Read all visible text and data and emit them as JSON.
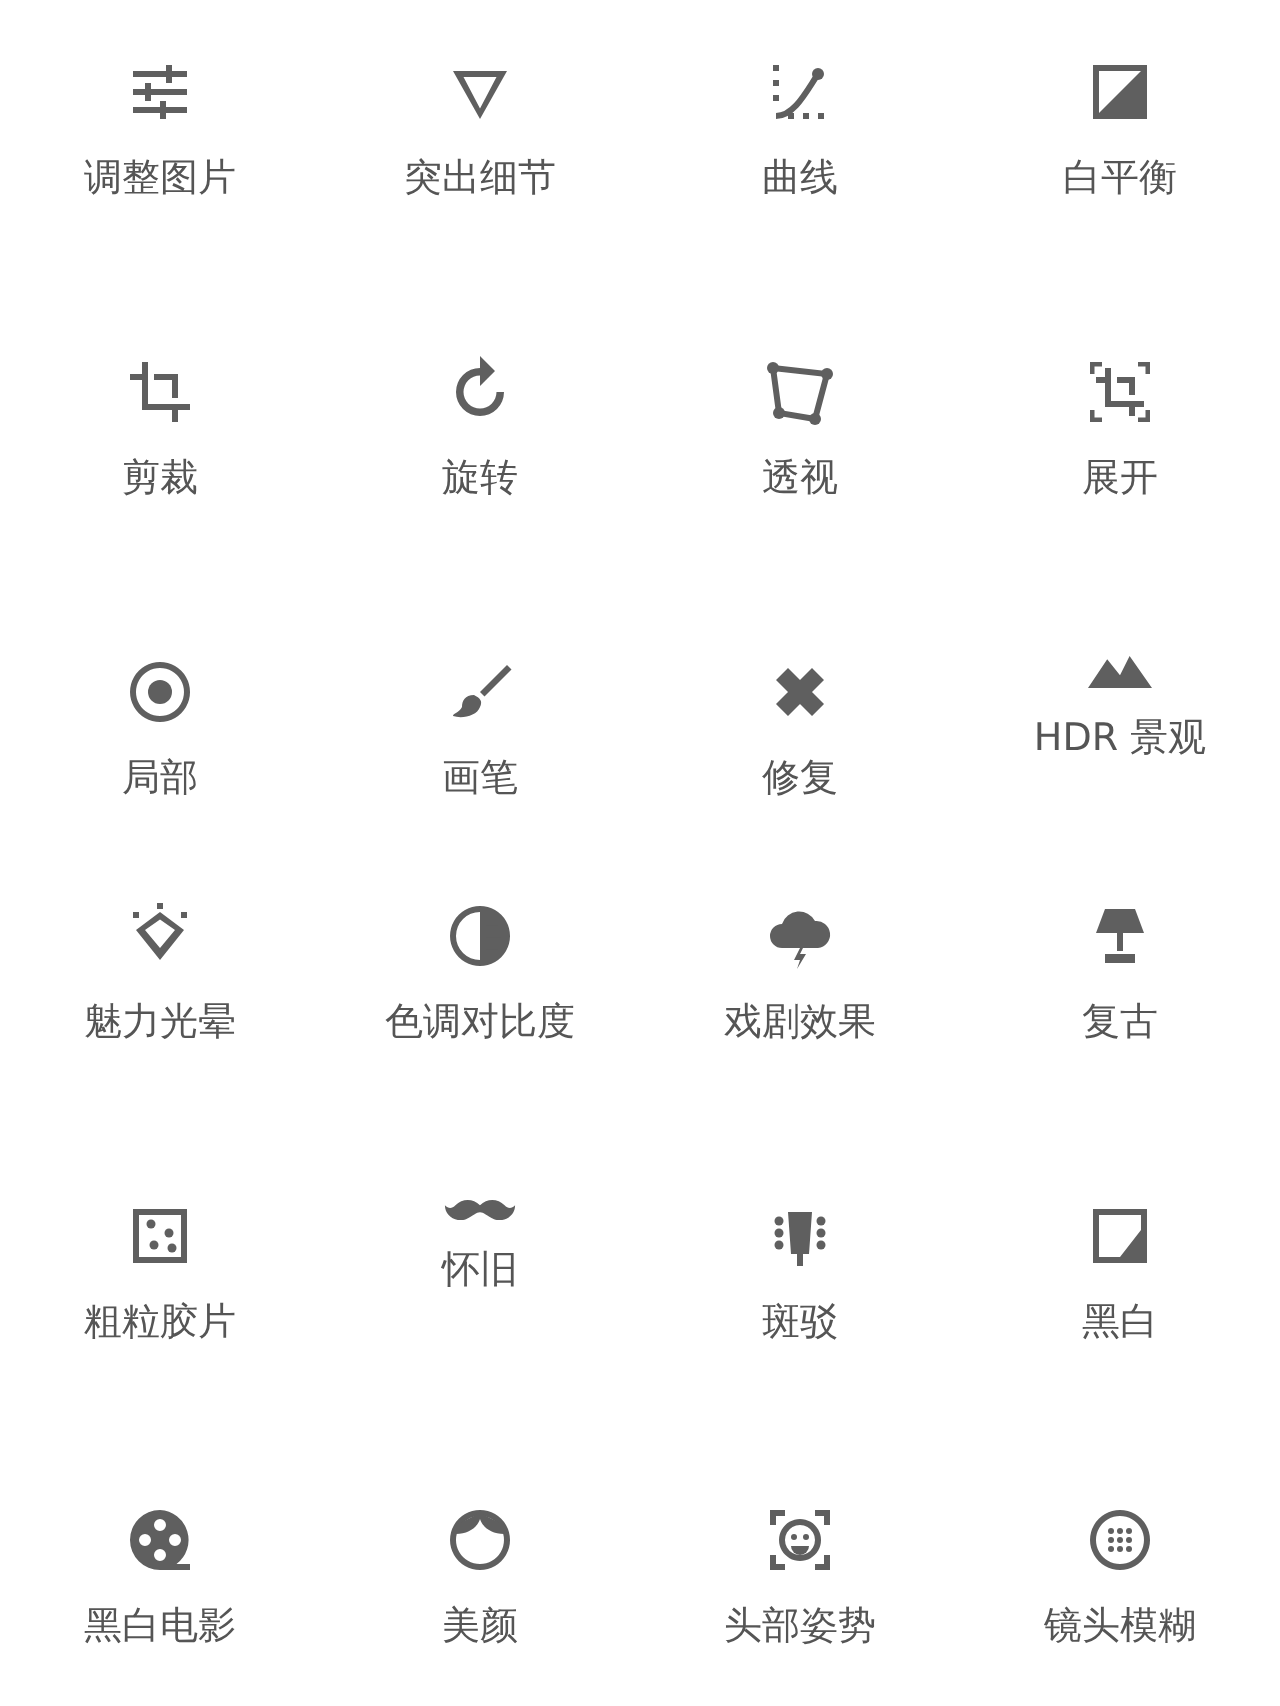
{
  "tools": [
    {
      "label": "调整图片"
    },
    {
      "label": "突出细节"
    },
    {
      "label": "曲线"
    },
    {
      "label": "白平衡"
    },
    {
      "label": "剪裁"
    },
    {
      "label": "旋转"
    },
    {
      "label": "透视"
    },
    {
      "label": "展开"
    },
    {
      "label": "局部"
    },
    {
      "label": "画笔"
    },
    {
      "label": "修复"
    },
    {
      "label": "HDR 景观"
    },
    {
      "label": "魅力光晕"
    },
    {
      "label": "色调对比度"
    },
    {
      "label": "戏剧效果"
    },
    {
      "label": "复古"
    },
    {
      "label": "粗粒胶片"
    },
    {
      "label": "怀旧"
    },
    {
      "label": "斑驳"
    },
    {
      "label": "黑白"
    },
    {
      "label": "黑白电影"
    },
    {
      "label": "美颜"
    },
    {
      "label": "头部姿势"
    },
    {
      "label": "镜头模糊"
    }
  ]
}
